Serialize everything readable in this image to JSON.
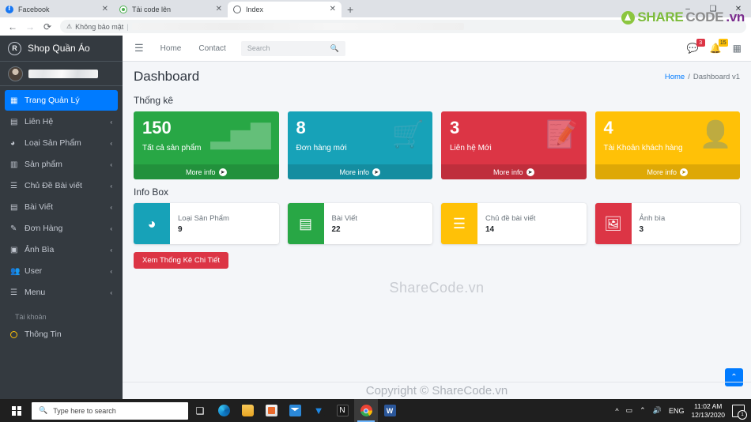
{
  "browser": {
    "tabs": [
      {
        "title": "Facebook",
        "favicon": "facebook-icon",
        "active": false
      },
      {
        "title": "Tải code lên",
        "favicon": "green-leaf-icon",
        "active": false
      },
      {
        "title": "Index",
        "favicon": "globe-icon",
        "active": true
      }
    ],
    "new_tab_label": "+",
    "window_controls": {
      "minimize": "–",
      "maximize": "❑",
      "close": "✕"
    },
    "nav": {
      "back": "←",
      "forward": "→",
      "reload": "⟳"
    },
    "omnibox": {
      "security_label": "Không bảo mật",
      "warning_icon": "warning-triangle-icon",
      "separator": "|"
    },
    "logo": {
      "mark": "sharecode-logo-icon",
      "part1": "SHARE",
      "part2": "CODE",
      "part3": ".vn"
    }
  },
  "sidebar": {
    "brand": {
      "initial": "R",
      "name": "Shop Quần Áo"
    },
    "user": {
      "avatar": "user-avatar",
      "name_redacted": true
    },
    "items": [
      {
        "label": "Trang Quản Lý",
        "icon": "grid-icon",
        "arrow": "",
        "active": true
      },
      {
        "label": "Liên Hệ",
        "icon": "contact-icon",
        "arrow": "‹",
        "active": false
      },
      {
        "label": "Loại Sản Phẩm",
        "icon": "pie-chart-icon",
        "arrow": "‹",
        "active": false
      },
      {
        "label": "Sản phẩm",
        "icon": "boxes-icon",
        "arrow": "‹",
        "active": false
      },
      {
        "label": "Chủ Đề Bài viết",
        "icon": "list-icon",
        "arrow": "‹",
        "active": false
      },
      {
        "label": "Bài Viết",
        "icon": "article-icon",
        "arrow": "‹",
        "active": false
      },
      {
        "label": "Đơn Hàng",
        "icon": "order-edit-icon",
        "arrow": "‹",
        "active": false
      },
      {
        "label": "Ảnh Bìa",
        "icon": "image-icon",
        "arrow": "‹",
        "active": false
      },
      {
        "label": "User",
        "icon": "users-icon",
        "arrow": "‹",
        "active": false
      },
      {
        "label": "Menu",
        "icon": "hamburger-icon",
        "arrow": "‹",
        "active": false
      }
    ],
    "section_header": "Tài khoản",
    "account_item": {
      "label": "Thông Tin",
      "icon": "circle-ring-icon"
    }
  },
  "navbar": {
    "hamburger": "hamburger-icon",
    "links": [
      "Home",
      "Contact"
    ],
    "search_placeholder": "Search",
    "search_icon": "search-icon",
    "messages": {
      "icon": "chat-icon",
      "count": "3",
      "color": "#dc3545"
    },
    "notifications": {
      "icon": "bell-icon",
      "count": "15",
      "color": "#ffc107"
    },
    "apps": {
      "icon": "grid-apps-icon"
    }
  },
  "page": {
    "title": "Dashboard",
    "breadcrumb": {
      "home": "Home",
      "sep": "/",
      "current": "Dashboard v1"
    }
  },
  "stats": {
    "section_title": "Thống kê",
    "more_info_label": "More info",
    "more_info_icon": "arrow-circle-right-icon",
    "boxes": [
      {
        "number": "150",
        "label": "Tất cả sản phẩm",
        "color": "#28a745",
        "icon": "bar-chart-icon"
      },
      {
        "number": "8",
        "label": "Đơn hàng mới",
        "color": "#17a2b8",
        "icon": "cart-icon"
      },
      {
        "number": "3",
        "label": "Liên hệ Mới",
        "color": "#dc3545",
        "icon": "document-edit-icon"
      },
      {
        "number": "4",
        "label": "Tài Khoản khách hàng",
        "color": "#ffc107",
        "icon": "user-plus-icon"
      }
    ]
  },
  "infobox": {
    "section_title": "Info Box",
    "boxes": [
      {
        "label": "Loại Sản Phẩm",
        "value": "9",
        "color": "#17a2b8",
        "icon": "pie-chart-icon"
      },
      {
        "label": "Bài Viết",
        "value": "22",
        "color": "#28a745",
        "icon": "article-icon"
      },
      {
        "label": "Chủ đề bài viết",
        "value": "14",
        "color": "#ffc107",
        "icon": "list-icon"
      },
      {
        "label": "Ảnh bìa",
        "value": "3",
        "color": "#dc3545",
        "icon": "image-icon"
      }
    ],
    "detail_button": "Xem Thống Kê Chi Tiết"
  },
  "watermarks": {
    "middle": "ShareCode.vn",
    "footer": "Copyright © ShareCode.vn"
  },
  "scroll_top_icon": "chevron-up-icon",
  "taskbar": {
    "start_icon": "windows-start-icon",
    "search_placeholder": "Type here to search",
    "search_icon": "search-icon",
    "task_view_icon": "task-view-icon",
    "apps": [
      {
        "name": "microsoft-store",
        "active": false
      },
      {
        "name": "mail",
        "active": false
      },
      {
        "name": "dropbox",
        "active": false
      },
      {
        "name": "notion",
        "active": false
      },
      {
        "name": "google-chrome",
        "active": true
      },
      {
        "name": "word",
        "active": false
      }
    ],
    "tray": {
      "chevron": "^",
      "battery_icon": "battery-icon",
      "wifi_icon": "wifi-icon",
      "volume_icon": "volume-icon",
      "language": "ENG",
      "time": "11:02 AM",
      "date": "12/13/2020",
      "notification_icon": "action-center-icon"
    }
  }
}
